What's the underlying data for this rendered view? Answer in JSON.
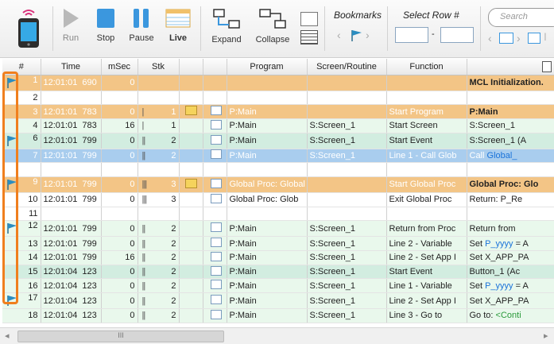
{
  "toolbar": {
    "run": "Run",
    "stop": "Stop",
    "pause": "Pause",
    "live": "Live",
    "expand": "Expand",
    "collapse": "Collapse",
    "bookmarks": "Bookmarks",
    "select_row": "Select Row #",
    "range_sep": "-",
    "search_placeholder": "Search"
  },
  "grid": {
    "headers": [
      "#",
      "Time",
      "mSec",
      "Stk",
      "",
      "",
      "Program",
      "Screen/Routine",
      "Function",
      ""
    ],
    "rows": [
      {
        "n": "1",
        "time": "12:01:01",
        "ms": "690",
        "msec": "0",
        "stk": "",
        "program": "",
        "screen": "",
        "func": "",
        "detail": "MCL Initialization.",
        "style": "orange",
        "flag": true
      },
      {
        "n": "2",
        "time": "",
        "ms": "",
        "msec": "",
        "stk": "",
        "program": "",
        "screen": "",
        "func": "",
        "detail": "",
        "style": "white",
        "flag": false
      },
      {
        "n": "3",
        "time": "12:01:01",
        "ms": "783",
        "msec": "0",
        "stk": "1",
        "program": "P:Main",
        "screen": "",
        "func": "Start Program",
        "detail": "P:Main",
        "style": "orange",
        "flag": false
      },
      {
        "n": "4",
        "time": "12:01:01",
        "ms": "783",
        "msec": "16",
        "stk": "1",
        "program": "P:Main",
        "screen": "S:Screen_1",
        "func": "Start Screen",
        "detail": "S:Screen_1",
        "style": "lgreen",
        "flag": false
      },
      {
        "n": "6",
        "time": "12:01:01",
        "ms": "799",
        "msec": "0",
        "stk": "2",
        "program": "P:Main",
        "screen": "S:Screen_1",
        "func": "Start Event",
        "detail": "S:Screen_1 (A",
        "style": "mgreen",
        "flag": true
      },
      {
        "n": "7",
        "time": "12:01:01",
        "ms": "799",
        "msec": "0",
        "stk": "2",
        "program": "P:Main",
        "screen": "S:Screen_1",
        "func": "Line 1 - Call Glob",
        "detail_pre": "Call ",
        "detail_blue": "Global_",
        "style": "sel",
        "flag": false
      },
      {
        "n": "",
        "time": "",
        "ms": "",
        "msec": "",
        "stk": "",
        "program": "",
        "screen": "",
        "func": "",
        "detail": "",
        "style": "white",
        "flag": false
      },
      {
        "n": "9",
        "time": "12:01:01",
        "ms": "799",
        "msec": "0",
        "stk": "3",
        "program": "Global Proc: Global",
        "screen": "",
        "func": "Start Global Proc",
        "detail": "Global Proc: Glo",
        "style": "orange",
        "flag": true
      },
      {
        "n": "10",
        "time": "12:01:01",
        "ms": "799",
        "msec": "0",
        "stk": "3",
        "program": "Global Proc: Glob",
        "screen": "",
        "func": "Exit Global Proc",
        "detail": "Return: P_Re",
        "style": "white",
        "flag": false
      },
      {
        "n": "11",
        "time": "",
        "ms": "",
        "msec": "",
        "stk": "",
        "program": "",
        "screen": "",
        "func": "",
        "detail": "",
        "style": "white",
        "flag": false
      },
      {
        "n": "12",
        "time": "12:01:01",
        "ms": "799",
        "msec": "0",
        "stk": "2",
        "program": "P:Main",
        "screen": "S:Screen_1",
        "func": "Return from Proc",
        "detail": "Return from",
        "style": "lgreen",
        "flag": true
      },
      {
        "n": "13",
        "time": "12:01:01",
        "ms": "799",
        "msec": "0",
        "stk": "2",
        "program": "P:Main",
        "screen": "S:Screen_1",
        "func": "Line 2 - Variable",
        "detail_pre": "Set ",
        "detail_blue": "P_yyyy",
        "detail_post": " = A",
        "style": "lgreen",
        "flag": false
      },
      {
        "n": "14",
        "time": "12:01:01",
        "ms": "799",
        "msec": "16",
        "stk": "2",
        "program": "P:Main",
        "screen": "S:Screen_1",
        "func": "Line 2 - Set App I",
        "detail": "Set X_APP_PA",
        "style": "lgreen",
        "flag": false
      },
      {
        "n": "15",
        "time": "12:01:04",
        "ms": "123",
        "msec": "0",
        "stk": "2",
        "program": "P:Main",
        "screen": "S:Screen_1",
        "func": "Start Event",
        "detail": "Button_1 (Ac",
        "style": "mgreen",
        "flag": false
      },
      {
        "n": "16",
        "time": "12:01:04",
        "ms": "123",
        "msec": "0",
        "stk": "2",
        "program": "P:Main",
        "screen": "S:Screen_1",
        "func": "Line 1 - Variable",
        "detail_pre": "Set ",
        "detail_blue": "P_yyyy",
        "detail_post": " = A",
        "style": "lgreen",
        "flag": false
      },
      {
        "n": "17",
        "time": "12:01:04",
        "ms": "123",
        "msec": "0",
        "stk": "2",
        "program": "P:Main",
        "screen": "S:Screen_1",
        "func": "Line 2 - Set App I",
        "detail": "Set X_APP_PA",
        "style": "lgreen",
        "flag": true
      },
      {
        "n": "18",
        "time": "12:01:04",
        "ms": "123",
        "msec": "0",
        "stk": "2",
        "program": "P:Main",
        "screen": "S:Screen_1",
        "func": "Line 3 - Go to",
        "detail_pre": "Go to: ",
        "detail_grn": "<Conti",
        "style": "lgreen",
        "flag": false
      }
    ]
  },
  "scrollbar": {
    "grip": "III"
  }
}
